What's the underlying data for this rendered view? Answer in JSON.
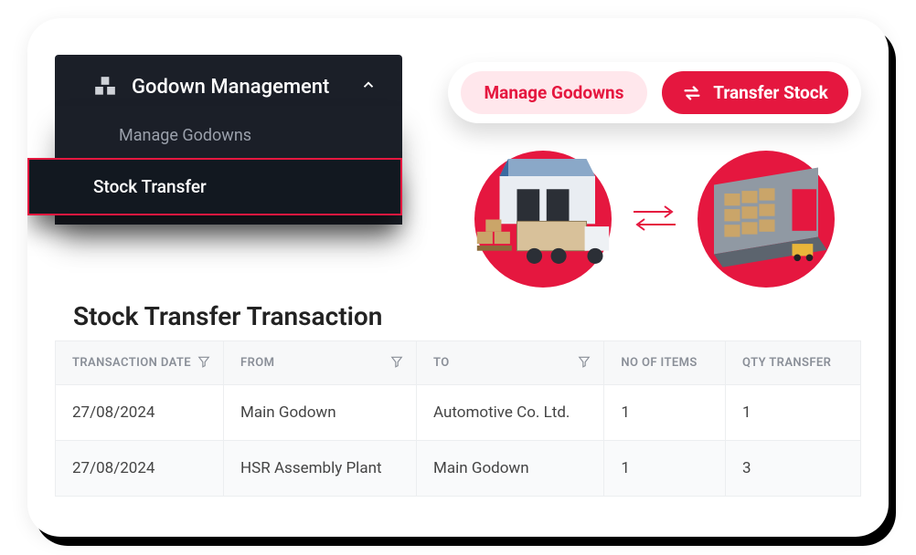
{
  "sidebar": {
    "title": "Godown Management",
    "items": [
      {
        "label": "Manage Godowns",
        "active": false
      },
      {
        "label": "Stock Transfer",
        "active": true
      }
    ]
  },
  "pillbar": {
    "manage_label": "Manage Godowns",
    "transfer_label": "Transfer Stock"
  },
  "table": {
    "title": "Stock Transfer Transaction",
    "headers": {
      "date": "TRANSACTION DATE",
      "from": "FROM",
      "to": "TO",
      "items": "NO OF ITEMS",
      "qty": "QTY TRANSFER"
    },
    "rows": [
      {
        "date": "27/08/2024",
        "from": "Main Godown",
        "to": "Automotive Co. Ltd.",
        "items": "1",
        "qty": "1"
      },
      {
        "date": "27/08/2024",
        "from": "HSR Assembly Plant",
        "to": "Main Godown",
        "items": "1",
        "qty": "3"
      }
    ]
  },
  "colors": {
    "accent": "#e5173f"
  }
}
